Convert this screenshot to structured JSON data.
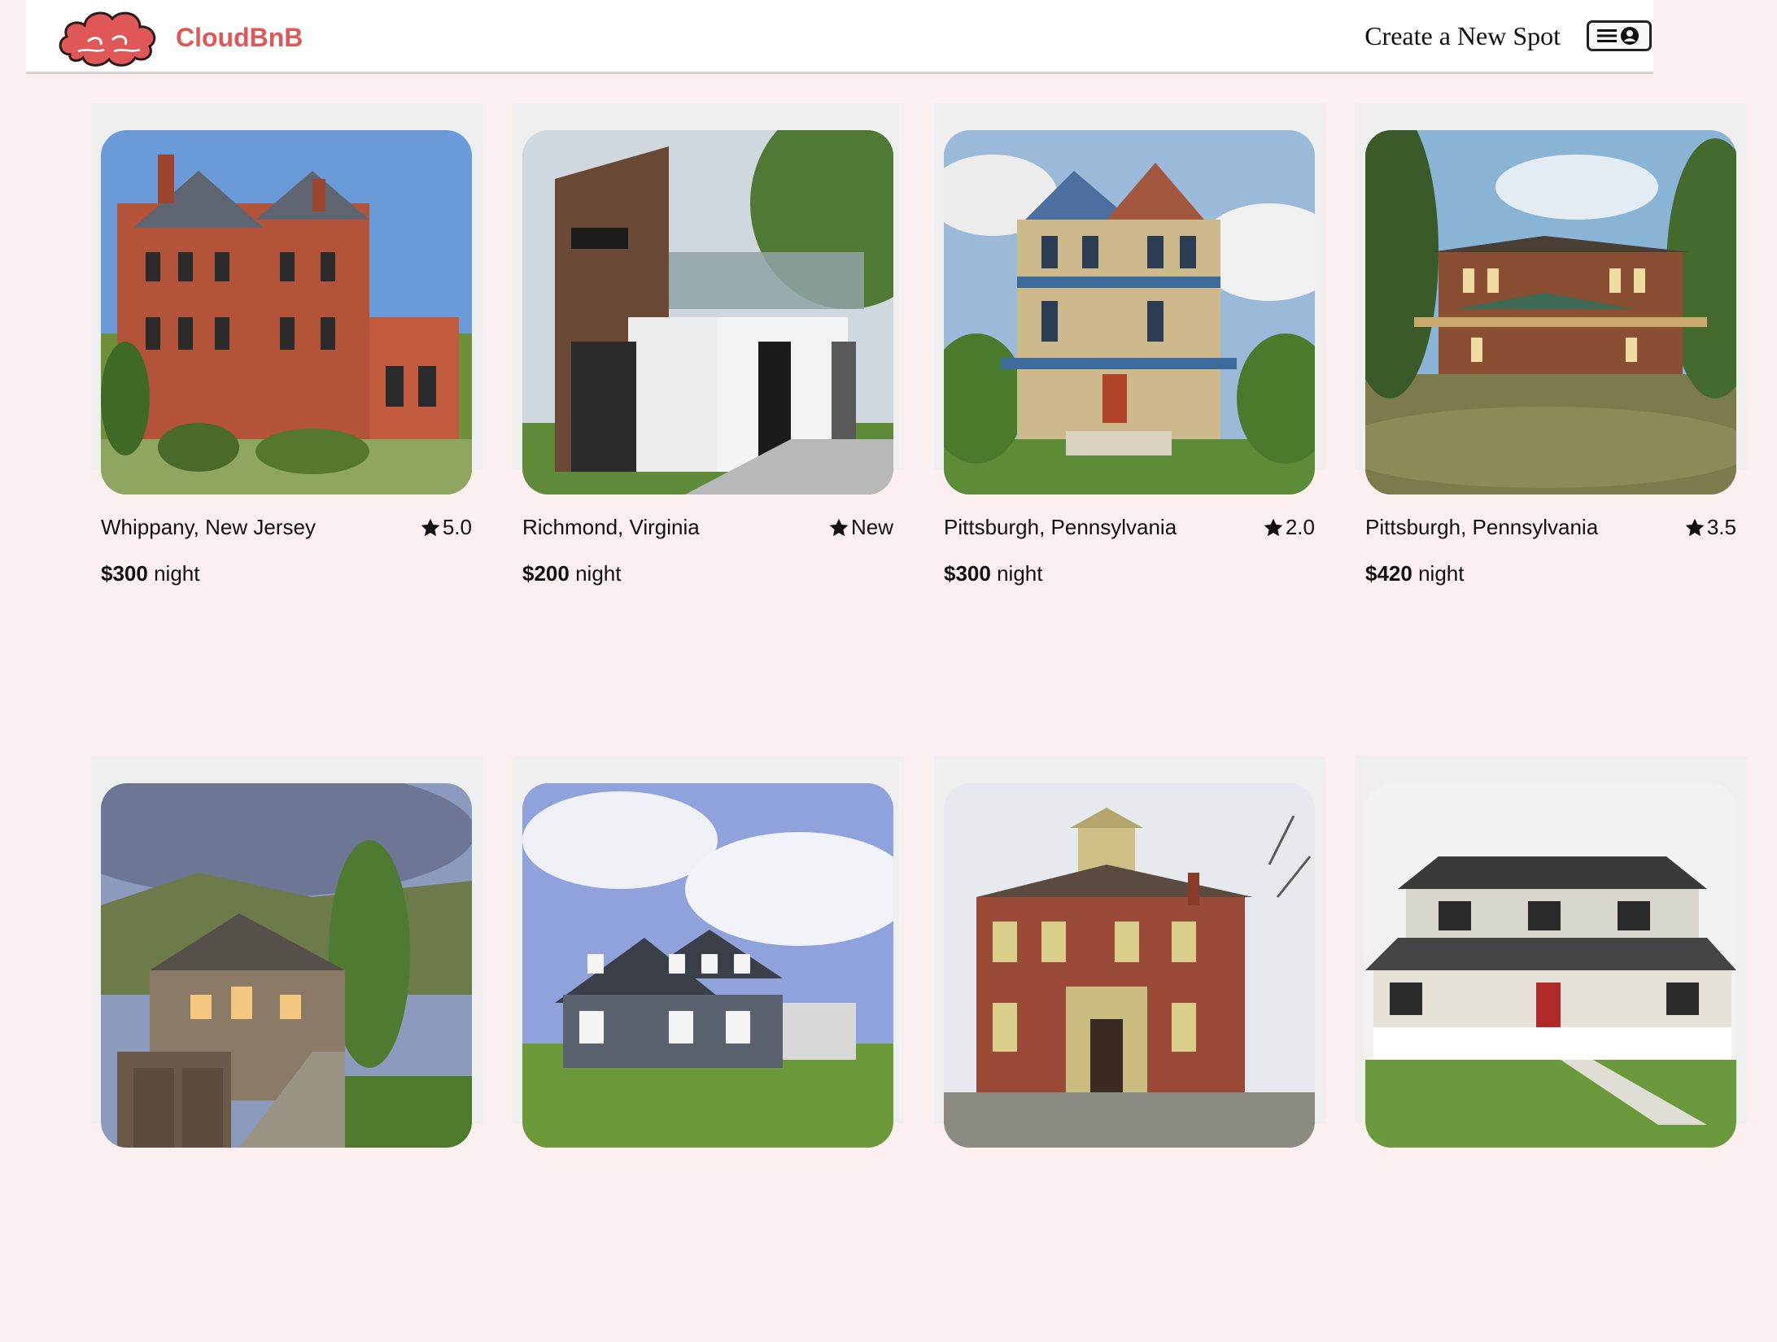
{
  "app": {
    "brand": "CloudBnB",
    "brand_color": "#e05757",
    "logo_icon": "red-cloud-logo"
  },
  "nav": {
    "create_spot": "Create a New Spot",
    "profile_icon": "menu-user-icon"
  },
  "spots": [
    {
      "location": "Whippany, New Jersey",
      "rating": "5.0",
      "price": "$300",
      "unit": "night",
      "image": "victorian-brick-mansion"
    },
    {
      "location": "Richmond, Virginia",
      "rating": "New",
      "price": "$200",
      "unit": "night",
      "image": "modern-house-wood-white"
    },
    {
      "location": "Pittsburgh, Pennsylvania",
      "rating": "2.0",
      "price": "$300",
      "unit": "night",
      "image": "painted-victorian-house"
    },
    {
      "location": "Pittsburgh, Pennsylvania",
      "rating": "3.5",
      "price": "$420",
      "unit": "night",
      "image": "prairie-style-brick-house"
    },
    {
      "location": "",
      "rating": "",
      "price": "",
      "unit": "",
      "image": "mountain-lodge-house"
    },
    {
      "location": "",
      "rating": "",
      "price": "",
      "unit": "",
      "image": "gray-craftsman-house"
    },
    {
      "location": "",
      "rating": "",
      "price": "",
      "unit": "",
      "image": "italianate-brick-house"
    },
    {
      "location": "",
      "rating": "",
      "price": "",
      "unit": "",
      "image": "white-farmhouse-porch"
    }
  ]
}
